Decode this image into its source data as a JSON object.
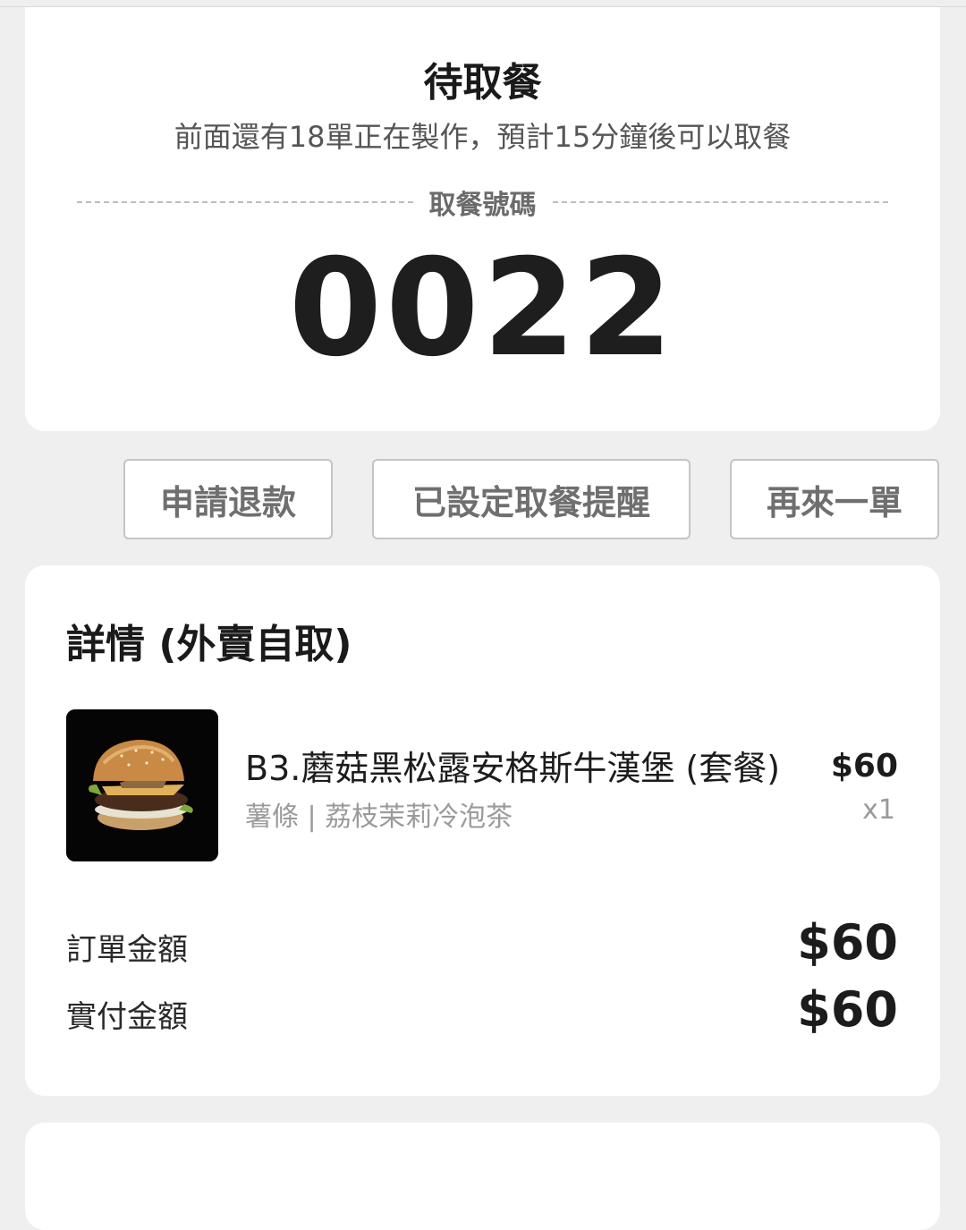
{
  "status": {
    "title": "待取餐",
    "subtitle": "前面還有18單正在製作，預計15分鐘後可以取餐",
    "pickup_label": "取餐號碼",
    "pickup_number": "0022"
  },
  "actions": {
    "refund_label": "申請退款",
    "reminder_label": "已設定取餐提醒",
    "reorder_label": "再來一單"
  },
  "details": {
    "title": "詳情 (外賣自取)",
    "item": {
      "name": "B3.蘑菇黑松露安格斯牛漢堡 (套餐)",
      "options": "薯條 | 荔枝茉莉冷泡茶",
      "price": "$60",
      "quantity": "x1",
      "image_icon": "burger-image"
    },
    "order_amount_label": "訂單金額",
    "order_amount": "$60",
    "paid_amount_label": "實付金額",
    "paid_amount": "$60"
  },
  "colors": {
    "background": "#efefef",
    "card": "#ffffff",
    "button_text": "#6f6f6f",
    "muted_text": "#9a9a9a"
  }
}
